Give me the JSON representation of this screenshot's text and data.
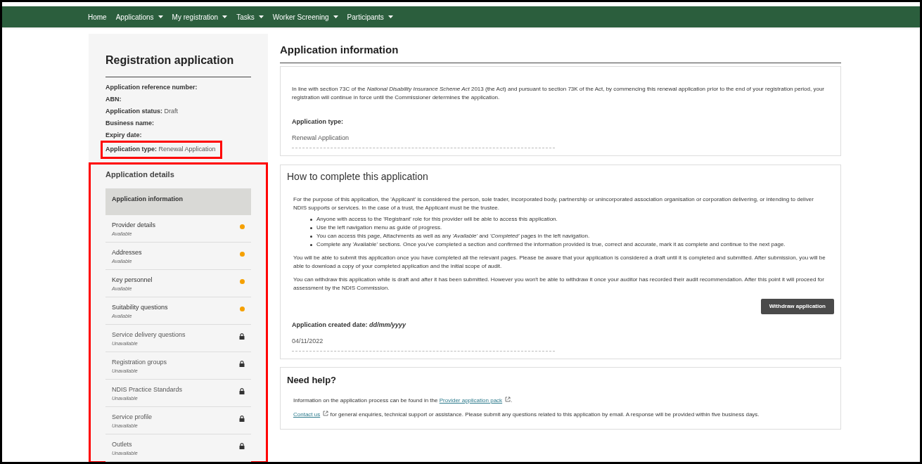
{
  "nav": [
    {
      "label": "Home",
      "dropdown": false
    },
    {
      "label": "Applications",
      "dropdown": true
    },
    {
      "label": "My registration",
      "dropdown": true
    },
    {
      "label": "Tasks",
      "dropdown": true
    },
    {
      "label": "Worker Screening",
      "dropdown": true
    },
    {
      "label": "Participants",
      "dropdown": true
    }
  ],
  "sidebar": {
    "title": "Registration application",
    "fields": [
      {
        "label": "Application reference number:",
        "highlighted": false
      },
      {
        "label": "ABN:",
        "highlighted": false
      },
      {
        "label": "Application status:",
        "value": "Draft",
        "highlighted": false
      },
      {
        "label": "Business name:",
        "highlighted": false
      },
      {
        "label": "Expiry date:",
        "highlighted": false
      },
      {
        "label": "Application type:",
        "value": "Renewal Application",
        "highlighted": true
      }
    ],
    "details_title": "Application details",
    "details_highlighted": true,
    "items": [
      {
        "label": "Application information",
        "selected": true,
        "kind": "plain"
      },
      {
        "label": "Provider details",
        "status": "Available",
        "selected": false,
        "kind": "available"
      },
      {
        "label": "Addresses",
        "status": "Available",
        "selected": false,
        "kind": "available"
      },
      {
        "label": "Key personnel",
        "status": "Available",
        "selected": false,
        "kind": "available"
      },
      {
        "label": "Suitability questions",
        "status": "Available",
        "selected": false,
        "kind": "available"
      },
      {
        "label": "Service delivery questions",
        "status": "Unavailable",
        "selected": false,
        "kind": "locked"
      },
      {
        "label": "Registration groups",
        "status": "Unavailable",
        "selected": false,
        "kind": "locked"
      },
      {
        "label": "NDIS Practice Standards",
        "status": "Unavailable",
        "selected": false,
        "kind": "locked"
      },
      {
        "label": "Service profile",
        "status": "Unavailable",
        "selected": false,
        "kind": "locked"
      },
      {
        "label": "Outlets",
        "status": "Unavailable",
        "selected": false,
        "kind": "locked"
      }
    ]
  },
  "main": {
    "title": "Application information",
    "intro": "In line with section 73C of the *National Disability Insurance Scheme Act* 2013 (the Act) and pursuant to section 73K of the Act, by commencing this renewal application prior to the end of your registration period, your registration will continue in force until the Commissioner determines the application.",
    "type_label": "Application type:",
    "type_value": "Renewal Application",
    "how": {
      "title": "How to complete this application",
      "paragraph": "For the purpose of this application, the 'Applicant' is considered the person, sole trader, incorporated body, partnership or unincorporated association organisation or corporation delivering, or intending to deliver NDIS supports or services. In the case of a trust, the Applicant must be the trustee.",
      "bullets": [
        "Anyone with access to the 'Registrant' role for this provider will be able to access this application.",
        "Use the left navigation menu as guide of progress.",
        "You can access this page, Attachments as well as any *'Available'* and *'Completed'* pages in the left navigation.",
        "Complete any 'Available' sections. Once you've completed a section and confirmed the information provided is true, correct and accurate, mark it as complete and continue to the next page."
      ],
      "paragraphs": [
        "You will be able to submit this application once you have completed all the relevant pages. Please be aware that your application is considered a draft until it is completed and submitted. After submission, you will be able to download a copy of your completed application and the initial scope of audit.",
        "You can withdraw this application while is draft and after it has been submitted. However you won't be able to withdraw it once your auditor has recorded their audit recommendation. After this point it will proceed for assessment by the NDIS Commission."
      ],
      "button": "Withdraw application",
      "date_label": "Application created date: *dd/mm/yyyy*",
      "date_value": "04/11/2022"
    },
    "help": {
      "title": "Need help?",
      "lines": [
        {
          "before": "Information on the application process can be found in the ",
          "link": "Provider application pack",
          "after": "."
        },
        {
          "link": "Contact us",
          "after": " for general enquiries, technical support or assistance. Please submit any questions related to this application by email. A response will be provided within five business days."
        }
      ]
    }
  }
}
